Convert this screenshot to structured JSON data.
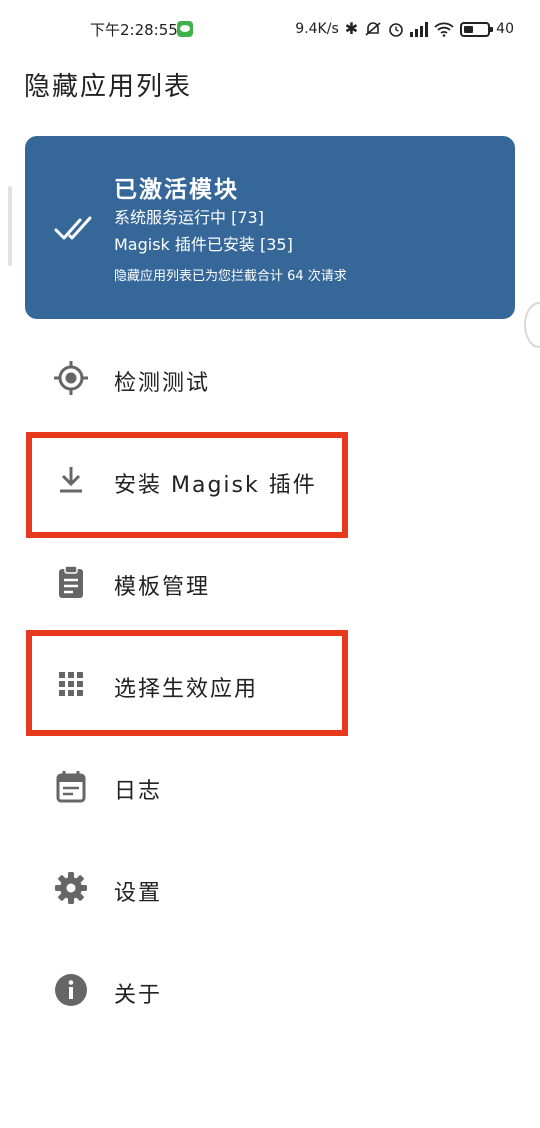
{
  "status_bar": {
    "time": "下午2:28:55",
    "net_speed": "9.4K/s",
    "battery": "40"
  },
  "app": {
    "title": "隐藏应用列表"
  },
  "status_card": {
    "title": "已激活模块",
    "line1": "系统服务运行中 [73]",
    "line2": "Magisk 插件已安装 [35]",
    "line3": "隐藏应用列表已为您拦截合计 64 次请求"
  },
  "menu": [
    {
      "id": "detection-test",
      "label": "检测测试",
      "icon": "crosshair-icon"
    },
    {
      "id": "install-magisk-plugin",
      "label": "安装 Magisk 插件",
      "icon": "download-icon"
    },
    {
      "id": "template-management",
      "label": "模板管理",
      "icon": "clipboard-icon"
    },
    {
      "id": "select-effective-apps",
      "label": "选择生效应用",
      "icon": "grid-icon"
    },
    {
      "id": "logs",
      "label": "日志",
      "icon": "calendar-icon"
    },
    {
      "id": "settings",
      "label": "设置",
      "icon": "gear-icon"
    },
    {
      "id": "about",
      "label": "关于",
      "icon": "info-icon"
    }
  ],
  "highlight_color": "#e8391d",
  "card_color": "#356799",
  "icon_color": "#666666"
}
